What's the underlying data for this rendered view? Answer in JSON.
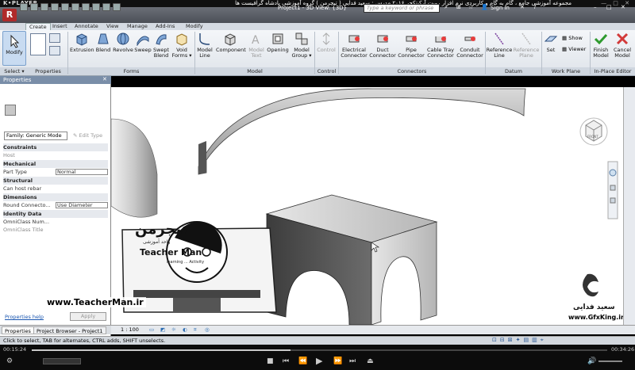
{
  "player": {
    "logo": "K•PLAYER",
    "title": "مجموعه آموزشی جامع ، گام به گام و کاربردی نرم افزار رویت آرکیتکچر ۲۰۱۶   مدرس : سعید فدایی ( تیچرمن ) گروه آموزشی پادشاه گرافیست ها",
    "time_current": "00:15:24",
    "time_total": "00:34:26",
    "progress": 0.45,
    "window_buttons": "— □ ✕"
  },
  "app": {
    "doc_title": "Project1 - 3D View: {3D}",
    "search_placeholder": "Type a keyword or phrase",
    "signin": "Sign In"
  },
  "ribbon": {
    "tabs": [
      {
        "label": "Create",
        "active": true
      },
      {
        "label": "Insert",
        "active": false
      },
      {
        "label": "Annotate",
        "active": false
      },
      {
        "label": "View",
        "active": false
      },
      {
        "label": "Manage",
        "active": false
      },
      {
        "label": "Add-Ins",
        "active": false
      },
      {
        "label": "Modify",
        "active": false
      }
    ],
    "panels": {
      "select": "Select ▾",
      "properties": "Properties",
      "forms": "Forms",
      "model": "Model",
      "control": "Control",
      "connectors": "Connectors",
      "datum": "Datum",
      "workplane": "Work Plane",
      "inplace": "In-Place Editor"
    },
    "buttons": {
      "modify": "Modify",
      "extrusion": "Extrusion",
      "blend": "Blend",
      "revolve": "Revolve",
      "sweep": "Sweep",
      "swept_blend_1": "Swept",
      "swept_blend_2": "Blend",
      "void_1": "Void",
      "void_2": "Forms ▾",
      "model_line_1": "Model",
      "model_line_2": "Line",
      "component": "Component",
      "model_text_1": "Model",
      "model_text_2": "Text",
      "opening": "Opening",
      "model_group_1": "Model",
      "model_group_2": "Group ▾",
      "control": "Control",
      "electrical_1": "Electrical",
      "electrical_2": "Connector",
      "duct_1": "Duct",
      "duct_2": "Connector",
      "pipe_1": "Pipe",
      "pipe_2": "Connector",
      "cable_1": "Cable Tray",
      "cable_2": "Connector",
      "conduit_1": "Conduit",
      "conduit_2": "Connector",
      "refline_1": "Reference",
      "refline_2": "Line",
      "refplane_1": "Reference",
      "refplane_2": "Plane",
      "set": "Set",
      "show": "Show",
      "viewer": "Viewer",
      "finish_1": "Finish",
      "finish_2": "Model",
      "cancel_1": "Cancel",
      "cancel_2": "Model"
    }
  },
  "properties": {
    "header": "Properties",
    "family": "Family: Generic Mode",
    "edit_type": "Edit Type",
    "groups": [
      {
        "name": "Constraints"
      },
      {
        "name": "Host",
        "value": ""
      },
      {
        "name": "Mechanical"
      },
      {
        "name": "Part Type",
        "value": "Normal"
      },
      {
        "name": "Structural"
      },
      {
        "name": "Can host rebar",
        "value": ""
      },
      {
        "name": "Dimensions"
      },
      {
        "name": "Round Connecto...",
        "value": "Use Diameter"
      },
      {
        "name": "Identity Data"
      },
      {
        "name": "OmniClass Num...",
        "value": ""
      },
      {
        "name": "OmniClass Title",
        "value": ""
      }
    ],
    "help": "Properties help",
    "apply": "Apply",
    "tab1": "Properties",
    "tab2": "Project Browser - Project1"
  },
  "view": {
    "scale": "1 : 100",
    "cube_label": "FRONT"
  },
  "status_bar": "Click to select, TAB for alternates, CTRL adds, SHIFT unselects.",
  "watermark": {
    "logo_fa": "تیچرمن",
    "logo_sub": "واحد آموزشی",
    "name": "Teacher Man",
    "tagline": "learning ... Activity",
    "url": "www.TeacherMan.ir",
    "brand_fa": "سعید فدایی",
    "brand_url": "www.GfxKing.ir"
  }
}
